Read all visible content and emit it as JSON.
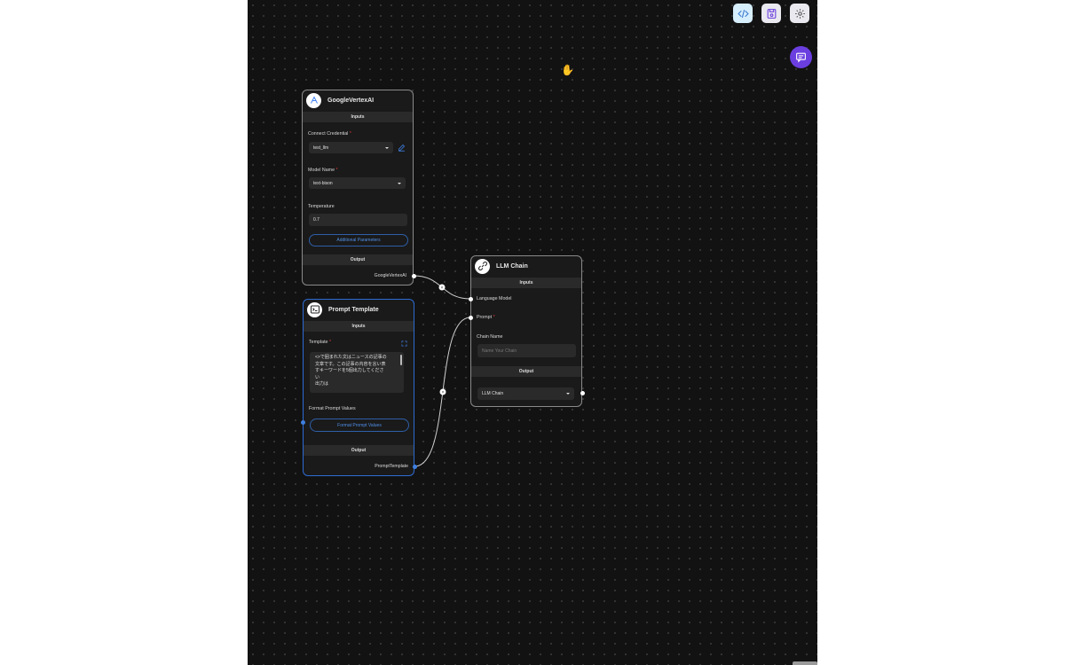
{
  "toolbar": {
    "buttons": [
      {
        "icon": "code-icon",
        "active": true
      },
      {
        "icon": "save-icon",
        "active": false
      },
      {
        "icon": "settings-icon",
        "active": false
      }
    ]
  },
  "chat": {
    "icon": "chat-bubble-icon"
  },
  "nodes": {
    "vertex": {
      "title": "GoogleVertexAI",
      "inputs_label": "Inputs",
      "credential_label": "Connect Credential",
      "credential_value": "test_llm",
      "model_label": "Model Name",
      "model_value": "text-bison",
      "temperature_label": "Temperature",
      "temperature_value": "0.7",
      "additional_params": "Additional Parameters",
      "output_label": "Output",
      "output_value": "GoogleVertexAI"
    },
    "prompt": {
      "title": "Prompt Template",
      "inputs_label": "Inputs",
      "template_label": "Template",
      "template_lines": [
        "<>で囲まれた文はニュースの記事の",
        "文章です。この記事の内容を言い表",
        "すキーワードを5個出力してくださ",
        "い",
        "出力は"
      ],
      "format_label": "Format Prompt Values",
      "format_button": "Format Prompt Values",
      "output_label": "Output",
      "output_value": "PromptTemplate"
    },
    "chain": {
      "title": "LLM Chain",
      "inputs_label": "Inputs",
      "language_model_label": "Language Model",
      "prompt_label": "Prompt",
      "chain_name_label": "Chain Name",
      "chain_name_placeholder": "Name Your Chain",
      "output_label": "Output",
      "output_value": "LLM Chain"
    }
  },
  "required_marker": "*",
  "colors": {
    "canvas": "#121212",
    "node_bg": "#1a1a1a",
    "accent_blue": "#3f7fe0",
    "chat_purple": "#6b3ee0"
  }
}
